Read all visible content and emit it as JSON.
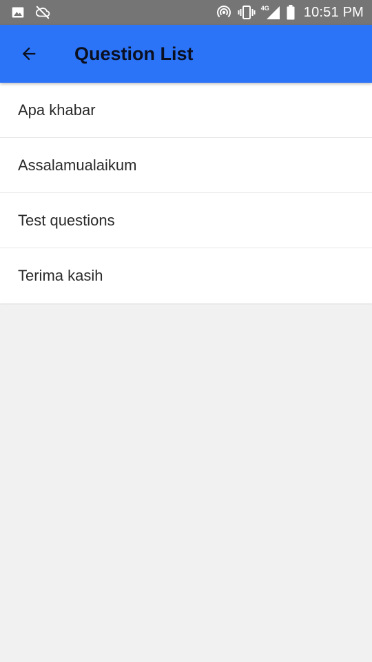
{
  "status_bar": {
    "time": "10:51 PM",
    "network": "4G",
    "icons_left": [
      "image-icon",
      "cloud-off-icon"
    ],
    "icons_right": [
      "hotspot-icon",
      "vibrate-icon",
      "signal-icon",
      "battery-icon"
    ]
  },
  "app_bar": {
    "title": "Question List",
    "back_icon": "back-arrow-icon",
    "color": "#2b74f8"
  },
  "questions": [
    {
      "label": "Apa khabar"
    },
    {
      "label": "Assalamualaikum"
    },
    {
      "label": "Test questions"
    },
    {
      "label": "Terima kasih"
    }
  ]
}
